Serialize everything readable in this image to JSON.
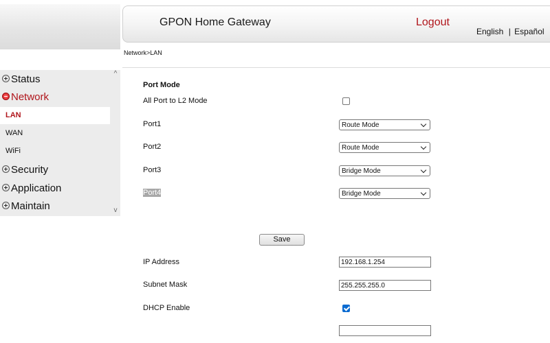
{
  "header": {
    "title": "GPON Home Gateway",
    "logout_label": "Logout",
    "lang_english": "English",
    "lang_separator": "|",
    "lang_spanish": "Español"
  },
  "breadcrumb": "Network>LAN",
  "sidebar": {
    "scroll_up": "^",
    "scroll_down": "v",
    "items": [
      {
        "label": "Status",
        "expanded": false
      },
      {
        "label": "Network",
        "expanded": true,
        "children": [
          "LAN",
          "WAN",
          "WiFi"
        ],
        "selected_child": "LAN"
      },
      {
        "label": "Security",
        "expanded": false
      },
      {
        "label": "Application",
        "expanded": false
      },
      {
        "label": "Maintain",
        "expanded": false
      }
    ],
    "network_children": {
      "lan": "LAN",
      "wan": "WAN",
      "wifi": "WiFi"
    }
  },
  "port_mode": {
    "section_title": "Port Mode",
    "all_port_label": "All Port to L2 Mode",
    "all_port_checked": false,
    "ports": [
      {
        "label": "Port1",
        "mode": "Route Mode"
      },
      {
        "label": "Port2",
        "mode": "Route Mode"
      },
      {
        "label": "Port3",
        "mode": "Bridge Mode"
      },
      {
        "label": "Port4",
        "mode": "Bridge Mode"
      }
    ],
    "save_label": "Save"
  },
  "lan_settings": {
    "ip_label": "IP Address",
    "ip_value": "192.168.1.254",
    "mask_label": "Subnet Mask",
    "mask_value": "255.255.255.0",
    "dhcp_label": "DHCP Enable",
    "dhcp_checked": true
  },
  "colors": {
    "accent_red": "#b0151b",
    "checkbox_blue": "#0b6bd1",
    "sidebar_bg": "#ececec"
  }
}
